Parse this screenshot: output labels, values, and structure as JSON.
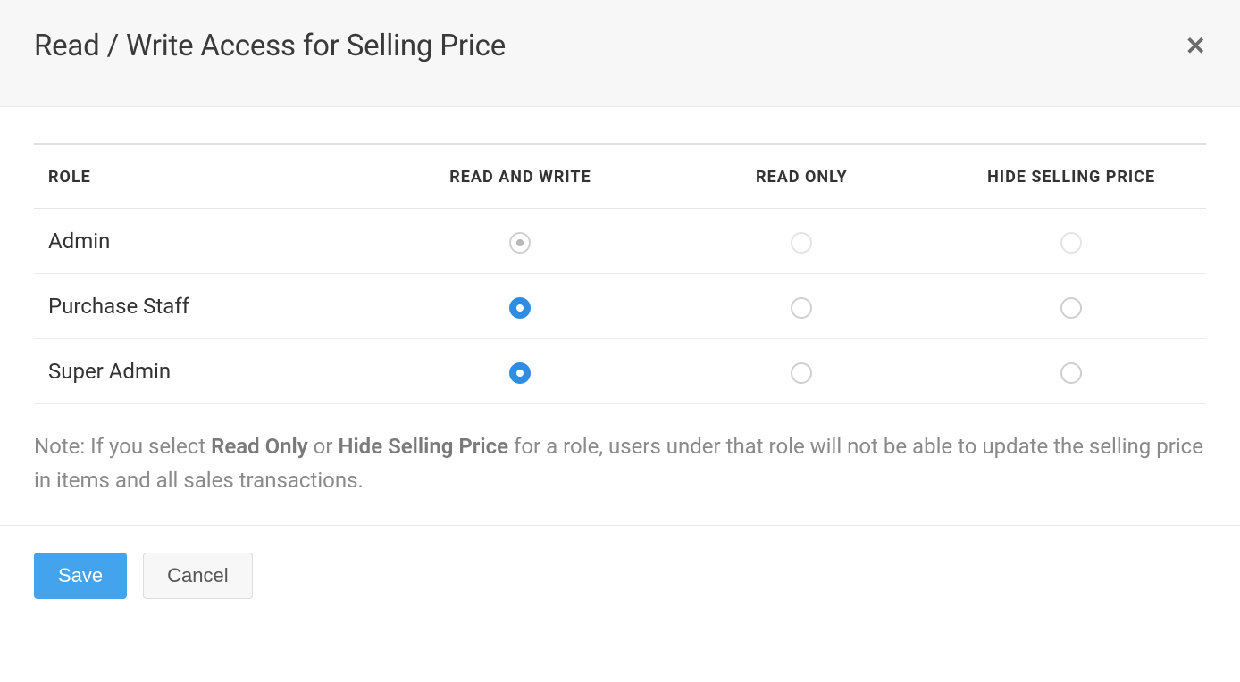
{
  "dialog": {
    "title": "Read / Write Access for Selling Price"
  },
  "table": {
    "headers": {
      "role": "ROLE",
      "read_write": "READ AND WRITE",
      "read_only": "READ ONLY",
      "hide": "HIDE SELLING PRICE"
    },
    "rows": [
      {
        "role": "Admin",
        "selection": "read_write",
        "locked": true
      },
      {
        "role": "Purchase Staff",
        "selection": "read_write",
        "locked": false
      },
      {
        "role": "Super Admin",
        "selection": "read_write",
        "locked": false
      }
    ]
  },
  "note": {
    "prefix": "Note: If you select ",
    "strong1": "Read Only",
    "mid": " or ",
    "strong2": "Hide Selling Price",
    "suffix": " for a role, users under that role will not be able to update the selling price in items and all sales transactions."
  },
  "footer": {
    "save_label": "Save",
    "cancel_label": "Cancel"
  }
}
